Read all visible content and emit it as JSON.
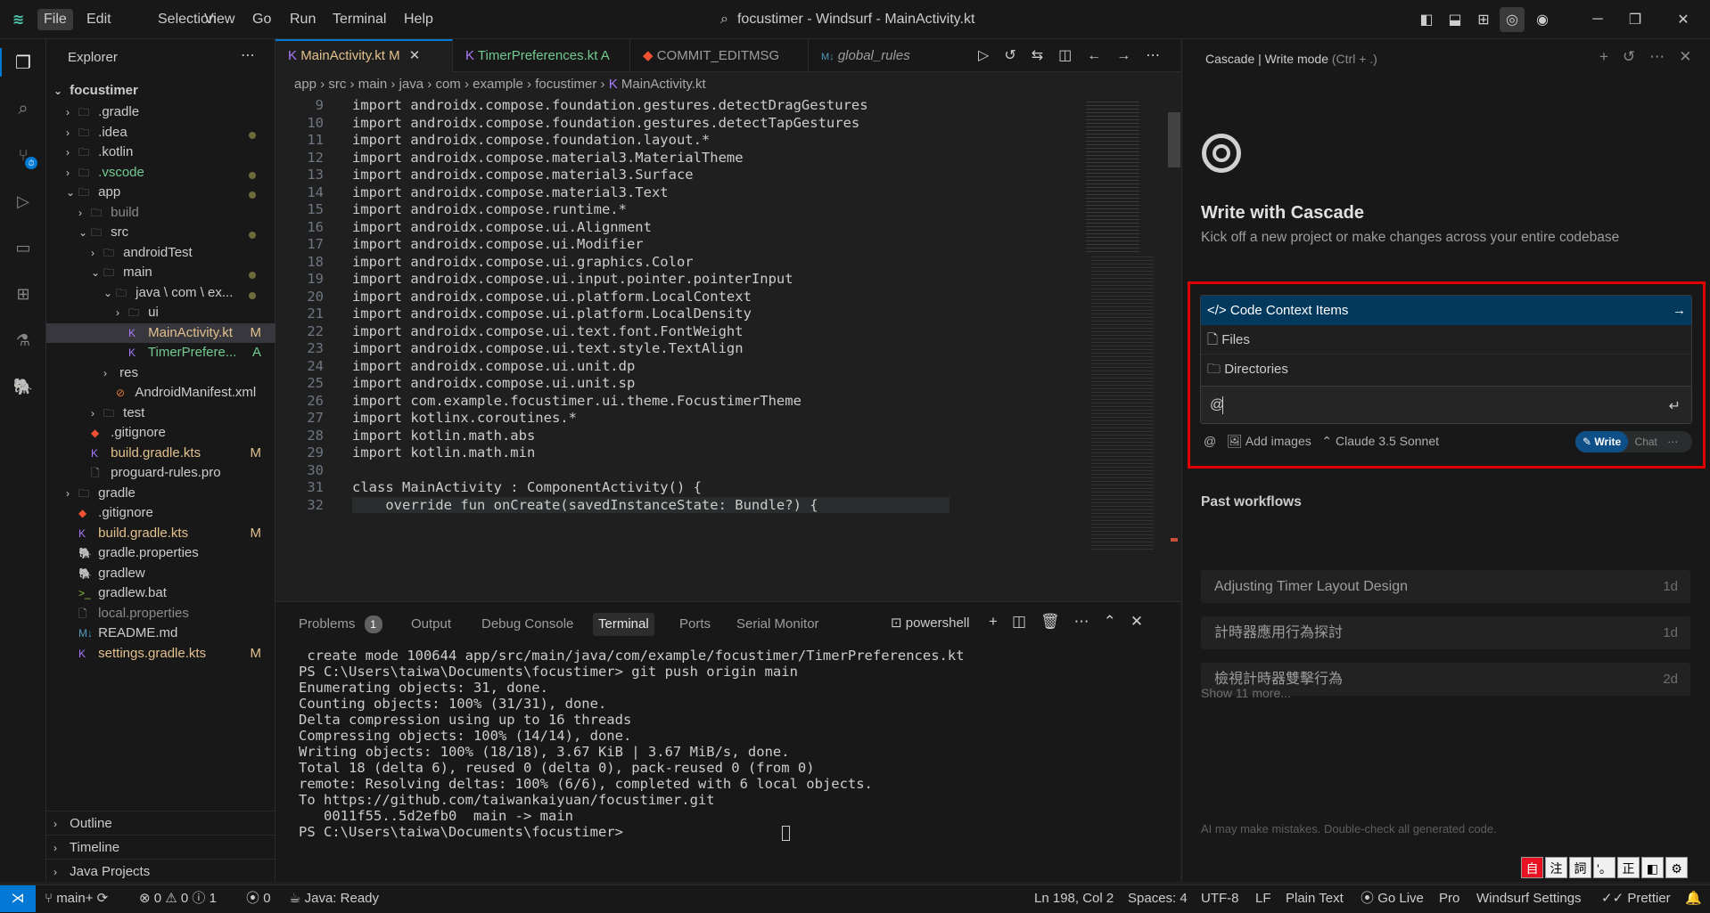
{
  "window": {
    "title": "focustimer - Windsurf - MainActivity.kt"
  },
  "menu": [
    "File",
    "Edit",
    "Selection",
    "View",
    "Go",
    "Run",
    "Terminal",
    "Help"
  ],
  "explorer": {
    "title": "Explorer",
    "project": "focustimer",
    "items": [
      {
        "label": ".gradle",
        "badge": ""
      },
      {
        "label": ".idea",
        "badge": ""
      },
      {
        "label": ".kotlin",
        "badge": ""
      },
      {
        "label": ".vscode",
        "badge": ""
      },
      {
        "label": "app",
        "badge": ""
      },
      {
        "label": "build",
        "badge": ""
      },
      {
        "label": "src",
        "badge": ""
      },
      {
        "label": "androidTest",
        "badge": ""
      },
      {
        "label": "main",
        "badge": ""
      },
      {
        "label": "java \\ com \\ ex...",
        "badge": ""
      },
      {
        "label": "ui",
        "badge": ""
      },
      {
        "label": "MainActivity.kt",
        "badge": "M"
      },
      {
        "label": "TimerPrefere...",
        "badge": "A"
      },
      {
        "label": "res",
        "badge": ""
      },
      {
        "label": "AndroidManifest.xml",
        "badge": ""
      },
      {
        "label": "test",
        "badge": ""
      },
      {
        "label": ".gitignore",
        "badge": ""
      },
      {
        "label": "build.gradle.kts",
        "badge": "M"
      },
      {
        "label": "proguard-rules.pro",
        "badge": ""
      },
      {
        "label": "gradle",
        "badge": ""
      },
      {
        "label": ".gitignore",
        "badge": ""
      },
      {
        "label": "build.gradle.kts",
        "badge": "M"
      },
      {
        "label": "gradle.properties",
        "badge": ""
      },
      {
        "label": "gradlew",
        "badge": ""
      },
      {
        "label": "gradlew.bat",
        "badge": ""
      },
      {
        "label": "local.properties",
        "badge": ""
      },
      {
        "label": "README.md",
        "badge": ""
      },
      {
        "label": "settings.gradle.kts",
        "badge": "M"
      }
    ],
    "sections": [
      "Outline",
      "Timeline",
      "Java Projects"
    ]
  },
  "tabs": [
    {
      "label": "MainActivity.kt",
      "badge": "M"
    },
    {
      "label": "TimerPreferences.kt",
      "badge": "A"
    },
    {
      "label": "COMMIT_EDITMSG",
      "badge": ""
    },
    {
      "label": "global_rules",
      "badge": ""
    }
  ],
  "breadcrumb": [
    "app",
    "src",
    "main",
    "java",
    "com",
    "example",
    "focustimer",
    "MainActivity.kt"
  ],
  "code": {
    "line_numbers": [
      "9",
      "10",
      "11",
      "12",
      "13",
      "14",
      "15",
      "16",
      "17",
      "18",
      "19",
      "20",
      "21",
      "22",
      "23",
      "24",
      "25",
      "26",
      "27",
      "28",
      "29",
      "30",
      "31",
      "32"
    ],
    "lines": [
      "import androidx.compose.foundation.gestures.detectDragGestures",
      "import androidx.compose.foundation.gestures.detectTapGestures",
      "import androidx.compose.foundation.layout.*",
      "import androidx.compose.material3.MaterialTheme",
      "import androidx.compose.material3.Surface",
      "import androidx.compose.material3.Text",
      "import androidx.compose.runtime.*",
      "import androidx.compose.ui.Alignment",
      "import androidx.compose.ui.Modifier",
      "import androidx.compose.ui.graphics.Color",
      "import androidx.compose.ui.input.pointer.pointerInput",
      "import androidx.compose.ui.platform.LocalContext",
      "import androidx.compose.ui.platform.LocalDensity",
      "import androidx.compose.ui.text.font.FontWeight",
      "import androidx.compose.ui.text.style.TextAlign",
      "import androidx.compose.ui.unit.dp",
      "import androidx.compose.ui.unit.sp",
      "import com.example.focustimer.ui.theme.FocustimerTheme",
      "import kotlinx.coroutines.*",
      "import kotlin.math.abs",
      "import kotlin.math.min",
      "",
      "class MainActivity : ComponentActivity() {",
      "    override fun onCreate(savedInstanceState: Bundle?) {"
    ]
  },
  "panel": {
    "tabs": [
      "Problems",
      "Output",
      "Debug Console",
      "Terminal",
      "Ports",
      "Serial Monitor"
    ],
    "problems_count": "1",
    "shell": "powershell",
    "terminal_lines": [
      " create mode 100644 app/src/main/java/com/example/focustimer/TimerPreferences.kt",
      "PS C:\\Users\\taiwa\\Documents\\focustimer> git push origin main",
      "Enumerating objects: 31, done.",
      "Counting objects: 100% (31/31), done.",
      "Delta compression using up to 16 threads",
      "Compressing objects: 100% (14/14), done.",
      "Writing objects: 100% (18/18), 3.67 KiB | 3.67 MiB/s, done.",
      "Total 18 (delta 6), reused 0 (delta 0), pack-reused 0 (from 0)",
      "remote: Resolving deltas: 100% (6/6), completed with 6 local objects.",
      "To https://github.com/taiwankaiyuan/focustimer.git",
      "   0011f55..5d2efb0  main -> main",
      "PS C:\\Users\\taiwa\\Documents\\focustimer> "
    ]
  },
  "cascade": {
    "header": "Cascade | Write mode",
    "shortcut": "(Ctrl + .)",
    "heading": "Write with Cascade",
    "subheading": "Kick off a new project or make changes across your entire codebase",
    "dropdown": [
      "Code Context Items",
      "Files",
      "Directories"
    ],
    "input_value": "@",
    "add_images": "Add images",
    "model": "Claude 3.5 Sonnet",
    "mode_write": "Write",
    "mode_chat": "Chat",
    "past_title": "Past workflows",
    "workflows": [
      {
        "title": "Adjusting Timer Layout Design",
        "age": "1d"
      },
      {
        "title": "計時器應用行為探討",
        "age": "1d"
      },
      {
        "title": "檢視計時器雙擊行為",
        "age": "2d"
      }
    ],
    "show_more": "Show 11 more...",
    "disclaimer": "AI may make mistakes. Double-check all generated code."
  },
  "ime": [
    "自",
    "注",
    "詞",
    "'。",
    "正",
    "◧",
    "⚙"
  ],
  "status": {
    "branch": "main+",
    "errors": "0",
    "warnings": "0",
    "infos": "1",
    "ports": "0",
    "java": "Java: Ready",
    "position": "Ln 198, Col 2",
    "spaces": "Spaces: 4",
    "encoding": "UTF-8",
    "eol": "LF",
    "language": "Plain Text",
    "golive": "Go Live",
    "pro": "Pro",
    "settings": "Windsurf Settings",
    "prettier": "Prettier"
  },
  "colors": {
    "accent": "#0078d4",
    "highlight_border": "#e00000",
    "kotlin": "#a97bff",
    "modified": "#e2c08d",
    "added": "#73c991"
  }
}
